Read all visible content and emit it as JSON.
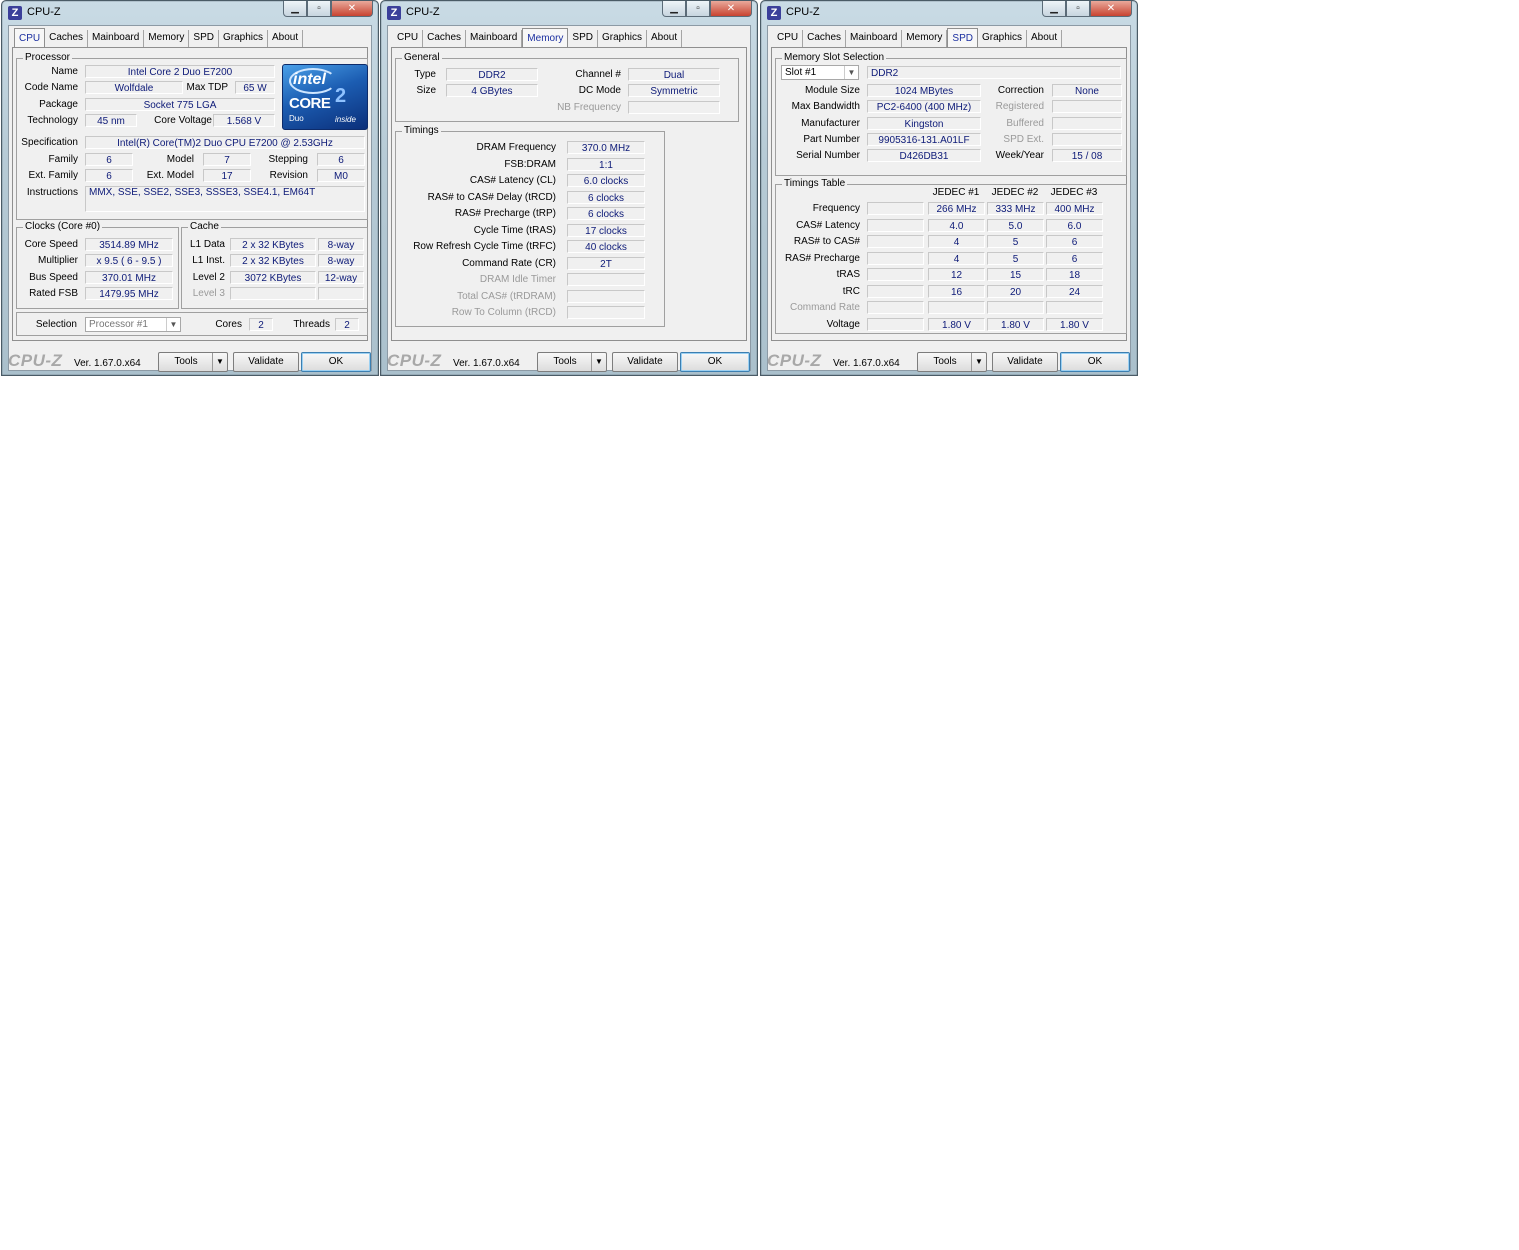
{
  "windows": [
    {
      "title": "CPU-Z",
      "active_tab": "CPU",
      "tabs": [
        "CPU",
        "Caches",
        "Mainboard",
        "Memory",
        "SPD",
        "Graphics",
        "About"
      ],
      "processor": {
        "group_title": "Processor",
        "name_label": "Name",
        "name": "Intel Core 2 Duo E7200",
        "code_name_label": "Code Name",
        "code_name": "Wolfdale",
        "max_tdp_label": "Max TDP",
        "max_tdp": "65 W",
        "package_label": "Package",
        "package": "Socket 775 LGA",
        "technology_label": "Technology",
        "technology": "45 nm",
        "core_voltage_label": "Core Voltage",
        "core_voltage": "1.568 V",
        "specification_label": "Specification",
        "specification": "Intel(R) Core(TM)2 Duo CPU     E7200  @ 2.53GHz",
        "family_label": "Family",
        "family": "6",
        "model_label": "Model",
        "model": "7",
        "stepping_label": "Stepping",
        "stepping": "6",
        "ext_family_label": "Ext. Family",
        "ext_family": "6",
        "ext_model_label": "Ext. Model",
        "ext_model": "17",
        "revision_label": "Revision",
        "revision": "M0",
        "instructions_label": "Instructions",
        "instructions": "MMX, SSE, SSE2, SSE3, SSSE3, SSE4.1, EM64T",
        "logo": {
          "brand": "intel",
          "line": "CORE",
          "sup": "2",
          "sub": "Duo",
          "tag": "inside"
        }
      },
      "clocks": {
        "group_title": "Clocks (Core #0)",
        "core_speed_label": "Core Speed",
        "core_speed": "3514.89 MHz",
        "multiplier_label": "Multiplier",
        "multiplier": "x 9.5  ( 6 - 9.5 )",
        "bus_speed_label": "Bus Speed",
        "bus_speed": "370.01 MHz",
        "rated_fsb_label": "Rated FSB",
        "rated_fsb": "1479.95 MHz"
      },
      "cache": {
        "group_title": "Cache",
        "l1_data_label": "L1 Data",
        "l1_data": "2 x 32 KBytes",
        "l1_data_way": "8-way",
        "l1_inst_label": "L1 Inst.",
        "l1_inst": "2 x 32 KBytes",
        "l1_inst_way": "8-way",
        "level2_label": "Level 2",
        "level2": "3072 KBytes",
        "level2_way": "12-way",
        "level3_label": "Level 3"
      },
      "selection": {
        "selection_label": "Selection",
        "selection": "Processor #1",
        "cores_label": "Cores",
        "cores": "2",
        "threads_label": "Threads",
        "threads": "2"
      },
      "footer": {
        "brand": "CPU-Z",
        "version": "Ver. 1.67.0.x64",
        "tools": "Tools",
        "validate": "Validate",
        "ok": "OK"
      }
    },
    {
      "title": "CPU-Z",
      "active_tab": "Memory",
      "tabs": [
        "CPU",
        "Caches",
        "Mainboard",
        "Memory",
        "SPD",
        "Graphics",
        "About"
      ],
      "general": {
        "group_title": "General",
        "type_label": "Type",
        "type": "DDR2",
        "size_label": "Size",
        "size": "4 GBytes",
        "channel_label": "Channel #",
        "channel": "Dual",
        "dc_mode_label": "DC Mode",
        "dc_mode": "Symmetric",
        "nb_frequency_label": "NB Frequency"
      },
      "timings": {
        "group_title": "Timings",
        "rows": [
          {
            "label": "DRAM Frequency",
            "value": "370.0 MHz",
            "dim": false
          },
          {
            "label": "FSB:DRAM",
            "value": "1:1",
            "dim": false
          },
          {
            "label": "CAS# Latency (CL)",
            "value": "6.0 clocks",
            "dim": false
          },
          {
            "label": "RAS# to CAS# Delay (tRCD)",
            "value": "6 clocks",
            "dim": false
          },
          {
            "label": "RAS# Precharge (tRP)",
            "value": "6 clocks",
            "dim": false
          },
          {
            "label": "Cycle Time (tRAS)",
            "value": "17 clocks",
            "dim": false
          },
          {
            "label": "Row Refresh Cycle Time (tRFC)",
            "value": "40 clocks",
            "dim": false
          },
          {
            "label": "Command Rate (CR)",
            "value": "2T",
            "dim": false
          },
          {
            "label": "DRAM Idle Timer",
            "value": "",
            "dim": true
          },
          {
            "label": "Total CAS# (tRDRAM)",
            "value": "",
            "dim": true
          },
          {
            "label": "Row To Column (tRCD)",
            "value": "",
            "dim": true
          }
        ]
      },
      "footer": {
        "brand": "CPU-Z",
        "version": "Ver. 1.67.0.x64",
        "tools": "Tools",
        "validate": "Validate",
        "ok": "OK"
      }
    },
    {
      "title": "CPU-Z",
      "active_tab": "SPD",
      "tabs": [
        "CPU",
        "Caches",
        "Mainboard",
        "Memory",
        "SPD",
        "Graphics",
        "About"
      ],
      "slot": {
        "group_title": "Memory Slot Selection",
        "slot": "Slot #1",
        "type": "DDR2",
        "module_size_label": "Module Size",
        "module_size": "1024 MBytes",
        "max_bandwidth_label": "Max Bandwidth",
        "max_bandwidth": "PC2-6400 (400 MHz)",
        "manufacturer_label": "Manufacturer",
        "manufacturer": "Kingston",
        "part_number_label": "Part Number",
        "part_number": "9905316-131.A01LF",
        "serial_number_label": "Serial Number",
        "serial_number": "D426DB31",
        "correction_label": "Correction",
        "correction": "None",
        "registered_label": "Registered",
        "buffered_label": "Buffered",
        "spd_ext_label": "SPD Ext.",
        "week_year_label": "Week/Year",
        "week_year": "15 / 08"
      },
      "timings_table": {
        "group_title": "Timings Table",
        "headers": [
          "JEDEC #1",
          "JEDEC #2",
          "JEDEC #3"
        ],
        "rows": [
          {
            "label": "Frequency",
            "values": [
              "266 MHz",
              "333 MHz",
              "400 MHz"
            ],
            "dim": false
          },
          {
            "label": "CAS# Latency",
            "values": [
              "4.0",
              "5.0",
              "6.0"
            ],
            "dim": false
          },
          {
            "label": "RAS# to CAS#",
            "values": [
              "4",
              "5",
              "6"
            ],
            "dim": false
          },
          {
            "label": "RAS# Precharge",
            "values": [
              "4",
              "5",
              "6"
            ],
            "dim": false
          },
          {
            "label": "tRAS",
            "values": [
              "12",
              "15",
              "18"
            ],
            "dim": false
          },
          {
            "label": "tRC",
            "values": [
              "16",
              "20",
              "24"
            ],
            "dim": false
          },
          {
            "label": "Command Rate",
            "values": [
              "",
              "",
              ""
            ],
            "dim": true
          },
          {
            "label": "Voltage",
            "values": [
              "1.80 V",
              "1.80 V",
              "1.80 V"
            ],
            "dim": false
          }
        ]
      },
      "footer": {
        "brand": "CPU-Z",
        "version": "Ver. 1.67.0.x64",
        "tools": "Tools",
        "validate": "Validate",
        "ok": "OK"
      }
    }
  ]
}
